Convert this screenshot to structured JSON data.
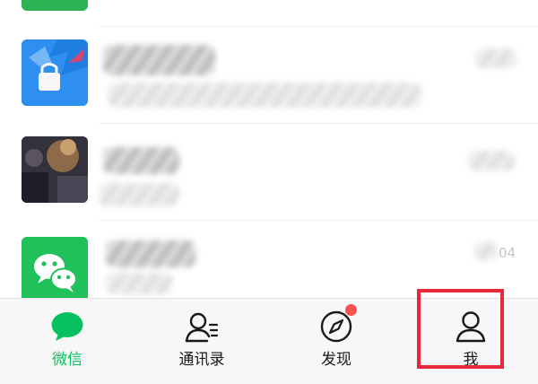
{
  "chat_list": {
    "rows": [
      {
        "avatar": "blue-app-avatar",
        "name": "",
        "message": "",
        "time": ""
      },
      {
        "avatar": "photo-avatar",
        "name": "",
        "message": "",
        "time": ""
      },
      {
        "avatar": "wechat-logo-avatar",
        "name": "",
        "message": "",
        "time": "04"
      }
    ]
  },
  "tab_bar": {
    "tabs": [
      {
        "label": "微信",
        "icon": "chat-bubbles-icon",
        "active": true
      },
      {
        "label": "通讯录",
        "icon": "contacts-icon",
        "active": false
      },
      {
        "label": "发现",
        "icon": "compass-icon",
        "active": false,
        "badge": "dot"
      },
      {
        "label": "我",
        "icon": "person-icon",
        "active": false
      }
    ]
  },
  "colors": {
    "accent": "#07c160",
    "badge": "#fa5151",
    "highlight": "#e8283a",
    "tab_bar_bg": "#f7f7f7"
  }
}
